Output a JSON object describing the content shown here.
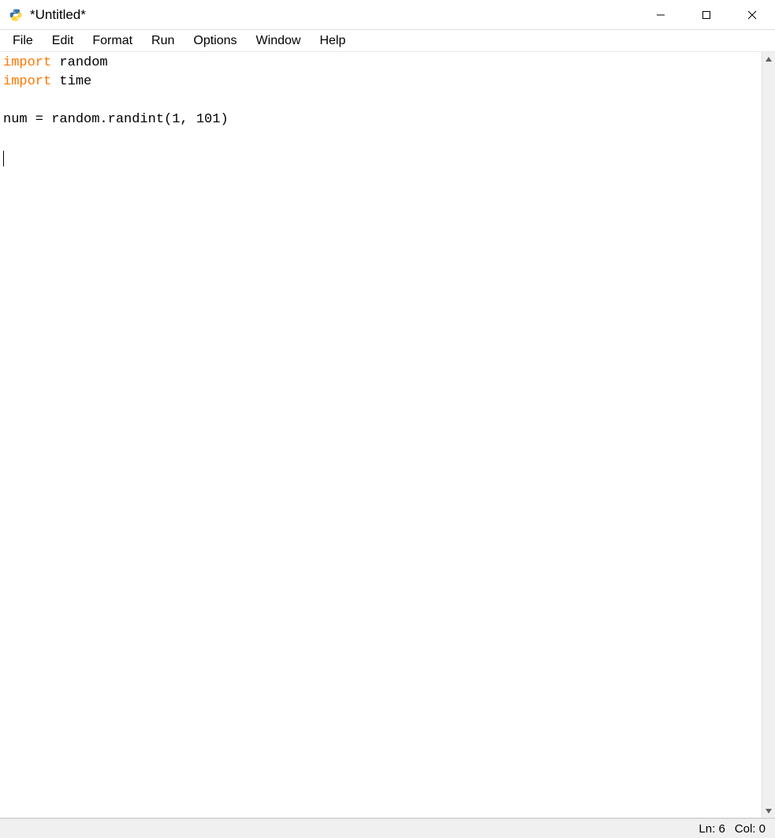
{
  "window": {
    "title": "*Untitled*"
  },
  "menu": {
    "items": [
      "File",
      "Edit",
      "Format",
      "Run",
      "Options",
      "Window",
      "Help"
    ]
  },
  "code": {
    "lines": [
      {
        "segments": [
          {
            "t": "import",
            "c": "kw"
          },
          {
            "t": " random",
            "c": ""
          }
        ]
      },
      {
        "segments": [
          {
            "t": "import",
            "c": "kw"
          },
          {
            "t": " time",
            "c": ""
          }
        ]
      },
      {
        "segments": []
      },
      {
        "segments": [
          {
            "t": "num = random.randint(1, 101)",
            "c": ""
          }
        ]
      },
      {
        "segments": []
      },
      {
        "segments": [],
        "cursor": true
      }
    ]
  },
  "status": {
    "ln_label": "Ln:",
    "ln_value": "6",
    "col_label": "Col:",
    "col_value": "0"
  }
}
